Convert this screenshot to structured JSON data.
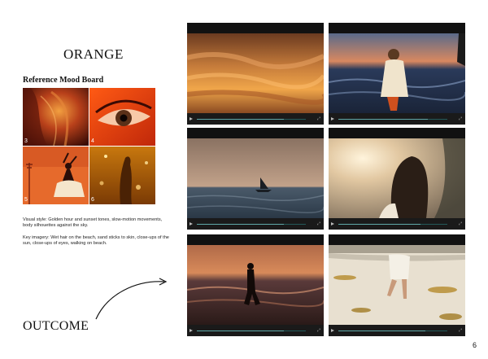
{
  "title": "ORANGE",
  "subtitle": "Reference Mood Board",
  "mood_board": [
    {
      "number": "3",
      "subject": "woman-wet-hair-golden"
    },
    {
      "number": "4",
      "subject": "eye-closeup-orange"
    },
    {
      "number": "5",
      "subject": "dancer-silhouette-orange"
    },
    {
      "number": "6",
      "subject": "silhouette-sun-glitter"
    }
  ],
  "visual_style": "Visual style: Golden hour and sunset tones, slow-motion movements, body silhouettes against the sky.",
  "key_imagery": "Key imagery: Wet hair on the beach, sand sticks to skin, close-ups of the sun, close-ups of eyes, walking on beach.",
  "outcome_label": "OUTCOME",
  "page_number": "6",
  "videos": [
    {
      "subject": "sunset-clouds",
      "progress": 0.8
    },
    {
      "subject": "woman-on-shore",
      "progress": 0.82
    },
    {
      "subject": "sailboat-at-sea",
      "progress": 0.8
    },
    {
      "subject": "woman-hair-sunlight",
      "progress": 0.75
    },
    {
      "subject": "silhouette-walking-shore",
      "progress": 0.8
    },
    {
      "subject": "feet-walking-sand",
      "progress": 0.8
    }
  ]
}
